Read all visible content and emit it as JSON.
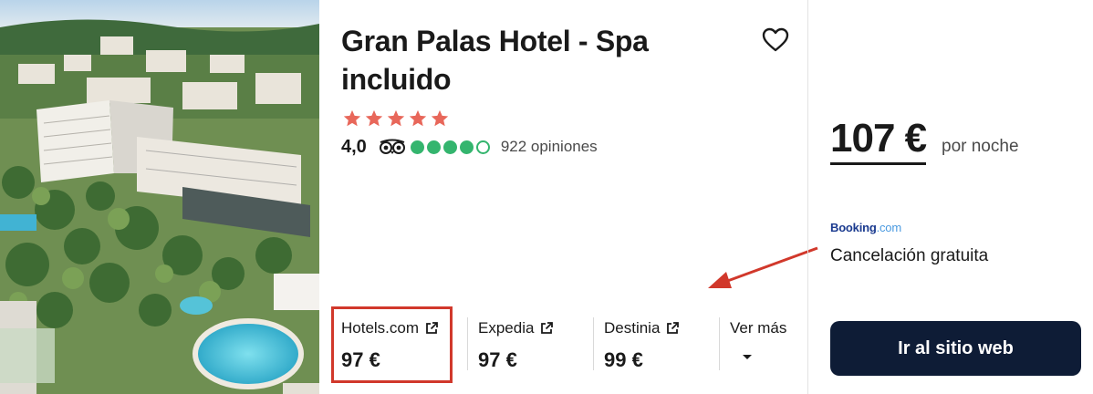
{
  "hotel": {
    "title": "Gran Palas Hotel - Spa incluido",
    "stars": 5,
    "rating": "4,0",
    "bubbles_filled": 4,
    "bubbles_total": 5,
    "reviews": "922 opiniones"
  },
  "providers": [
    {
      "name": "Hotels.com",
      "price": "97 €",
      "highlighted": true
    },
    {
      "name": "Expedia",
      "price": "97 €"
    },
    {
      "name": "Destinia",
      "price": "99 €"
    }
  ],
  "more": {
    "label": "Ver más"
  },
  "offer": {
    "price": "107 €",
    "per_night": "por noche",
    "partner_brand": "Booking",
    "partner_suffix": ".com",
    "cancellation": "Cancelación gratuita",
    "cta_label": "Ir al sitio web"
  },
  "colors": {
    "star": "#e8675a",
    "bubble": "#34b56e",
    "highlight": "#d1382b",
    "cta_bg": "#0e1c36",
    "booking_blue": "#1a3a8f"
  },
  "icons": [
    "heart-icon",
    "star-icon",
    "tripadvisor-owl-icon",
    "external-link-icon",
    "chevron-down-icon",
    "annotation-arrow"
  ]
}
